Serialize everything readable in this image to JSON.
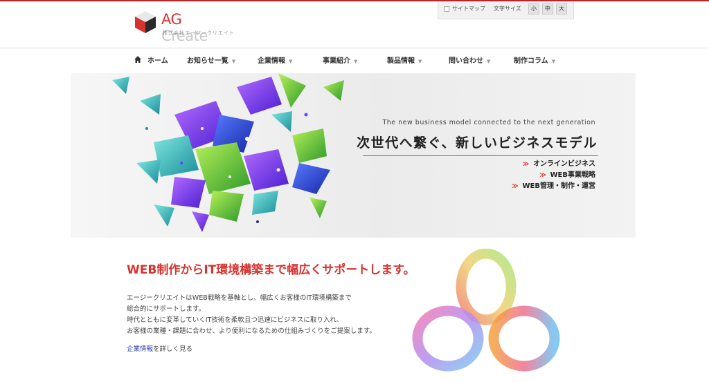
{
  "brand": {
    "name_first": "AG",
    "name_rest": " Create",
    "subtitle": "株式会社エージークリエイト"
  },
  "utility": {
    "sitemap_label": "サイトマップ",
    "fontsize_label": "文字サイズ",
    "size_small": "小",
    "size_medium": "中",
    "size_large": "大"
  },
  "nav": {
    "items": [
      {
        "label": "ホーム"
      },
      {
        "label": "お知らせ一覧"
      },
      {
        "label": "企業情報"
      },
      {
        "label": "事業紹介"
      },
      {
        "label": "製品情報"
      },
      {
        "label": "問い合わせ"
      },
      {
        "label": "制作コラム"
      }
    ],
    "caret": "▼"
  },
  "hero": {
    "tagline_en": "The new business model connected to the next generation",
    "tagline_ja": "次世代へ繋ぐ、新しいビジネスモデル",
    "bullet": "≫",
    "items": [
      "オンラインビジネス",
      "WEB事業戦略",
      "WEB管理・制作・運営"
    ]
  },
  "content": {
    "heading": "WEB制作からIT環境構築まで幅広くサポートします。",
    "paragraph_lines": [
      "エージークリエイトはWEB戦略を基軸とし、幅広くお客様のIT環境構築まで",
      "総合的にサポートします。",
      "時代とともに変革していくIT技術を柔軟且つ迅速にビジネスに取り入れ、",
      "お客様の業種・課題に合わせ、より便利になるための仕組みづくりをご提案します。"
    ],
    "link_text": "企業情報",
    "link_suffix": "を詳しく見る"
  },
  "colors": {
    "accent_red": "#d8322f",
    "link_blue": "#2a3fa8",
    "nav_text": "#333333"
  }
}
